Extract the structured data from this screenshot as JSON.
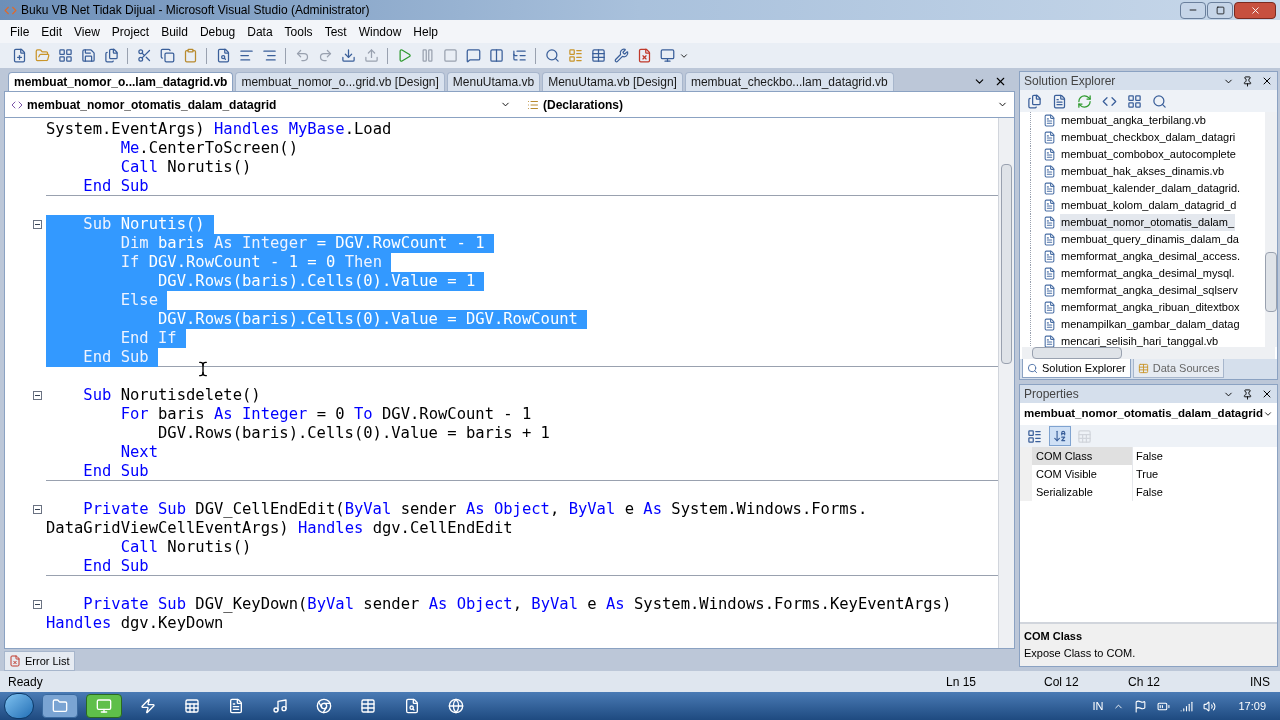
{
  "window": {
    "title": "Buku VB Net Tidak Dijual - Microsoft Visual Studio (Administrator)"
  },
  "menu": [
    "File",
    "Edit",
    "View",
    "Project",
    "Build",
    "Debug",
    "Data",
    "Tools",
    "Test",
    "Window",
    "Help"
  ],
  "document_tabs": [
    {
      "label": "membuat_nomor_o...lam_datagrid.vb",
      "selected": true
    },
    {
      "label": "membuat_nomor_o...grid.vb [Design]",
      "selected": false
    },
    {
      "label": "MenuUtama.vb",
      "selected": false
    },
    {
      "label": "MenuUtama.vb [Design]",
      "selected": false
    },
    {
      "label": "membuat_checkbo...lam_datagrid.vb",
      "selected": false
    }
  ],
  "navigation": {
    "class_dropdown": "membuat_nomor_otomatis_dalam_datagrid",
    "member_dropdown": "(Declarations)"
  },
  "code_lines": [
    {
      "kind": "code",
      "tokens": [
        {
          "text": "System.EventArgs) ",
          "kind": "plain"
        },
        {
          "text": "Handles MyBase",
          "kind": "keyword"
        },
        {
          "text": ".Load",
          "kind": "plain"
        }
      ],
      "selected": false,
      "collapsible": false,
      "separator": false
    },
    {
      "kind": "code",
      "tokens": [
        {
          "text": "        Me",
          "kind": "keyword"
        },
        {
          "text": ".CenterToScreen()",
          "kind": "plain"
        }
      ],
      "selected": false,
      "collapsible": false,
      "separator": false
    },
    {
      "kind": "code",
      "tokens": [
        {
          "text": "        Call",
          "kind": "keyword"
        },
        {
          "text": " Norutis()",
          "kind": "plain"
        }
      ],
      "selected": false,
      "collapsible": false,
      "separator": false
    },
    {
      "kind": "code",
      "tokens": [
        {
          "text": "    End Sub",
          "kind": "keyword"
        }
      ],
      "selected": false,
      "collapsible": false,
      "separator": true
    },
    {
      "kind": "blank"
    },
    {
      "kind": "code",
      "tokens": [
        {
          "text": "    Sub",
          "kind": "keyword"
        },
        {
          "text": " Norutis()",
          "kind": "plain"
        }
      ],
      "selected": true,
      "collapsible": true,
      "separator": false
    },
    {
      "kind": "code",
      "tokens": [
        {
          "text": "        Dim",
          "kind": "keyword"
        },
        {
          "text": " baris ",
          "kind": "plain"
        },
        {
          "text": "As Integer",
          "kind": "keyword"
        },
        {
          "text": " = DGV.RowCount - 1",
          "kind": "plain"
        }
      ],
      "selected": true,
      "collapsible": false,
      "separator": false
    },
    {
      "kind": "code",
      "tokens": [
        {
          "text": "        If",
          "kind": "keyword"
        },
        {
          "text": " DGV.RowCount - 1 = 0 ",
          "kind": "plain"
        },
        {
          "text": "Then",
          "kind": "keyword"
        }
      ],
      "selected": true,
      "collapsible": false,
      "separator": false
    },
    {
      "kind": "code",
      "tokens": [
        {
          "text": "            DGV.Rows(baris).Cells(0).Value = 1",
          "kind": "plain"
        }
      ],
      "selected": true,
      "collapsible": false,
      "separator": false
    },
    {
      "kind": "code",
      "tokens": [
        {
          "text": "        Else",
          "kind": "keyword"
        }
      ],
      "selected": true,
      "collapsible": false,
      "separator": false
    },
    {
      "kind": "code",
      "tokens": [
        {
          "text": "            DGV.Rows(baris).Cells(0).Value = DGV.RowCount",
          "kind": "plain"
        }
      ],
      "selected": true,
      "collapsible": false,
      "separator": false
    },
    {
      "kind": "code",
      "tokens": [
        {
          "text": "        End If",
          "kind": "keyword"
        }
      ],
      "selected": true,
      "collapsible": false,
      "separator": false
    },
    {
      "kind": "code",
      "tokens": [
        {
          "text": "    End Sub",
          "kind": "keyword"
        }
      ],
      "selected": true,
      "collapsible": false,
      "separator": true
    },
    {
      "kind": "blank"
    },
    {
      "kind": "code",
      "tokens": [
        {
          "text": "    Sub",
          "kind": "keyword"
        },
        {
          "text": " Norutisdelete()",
          "kind": "plain"
        }
      ],
      "selected": false,
      "collapsible": true,
      "separator": false
    },
    {
      "kind": "code",
      "tokens": [
        {
          "text": "        For",
          "kind": "keyword"
        },
        {
          "text": " baris ",
          "kind": "plain"
        },
        {
          "text": "As Integer",
          "kind": "keyword"
        },
        {
          "text": " = 0 ",
          "kind": "plain"
        },
        {
          "text": "To",
          "kind": "keyword"
        },
        {
          "text": " DGV.RowCount - 1",
          "kind": "plain"
        }
      ],
      "selected": false,
      "collapsible": false,
      "separator": false
    },
    {
      "kind": "code",
      "tokens": [
        {
          "text": "            DGV.Rows(baris).Cells(0).Value = baris + 1",
          "kind": "plain"
        }
      ],
      "selected": false,
      "collapsible": false,
      "separator": false
    },
    {
      "kind": "code",
      "tokens": [
        {
          "text": "        Next",
          "kind": "keyword"
        }
      ],
      "selected": false,
      "collapsible": false,
      "separator": false
    },
    {
      "kind": "code",
      "tokens": [
        {
          "text": "    End Sub",
          "kind": "keyword"
        }
      ],
      "selected": false,
      "collapsible": false,
      "separator": true
    },
    {
      "kind": "blank"
    },
    {
      "kind": "code",
      "tokens": [
        {
          "text": "    Private Sub",
          "kind": "keyword"
        },
        {
          "text": " DGV_CellEndEdit(",
          "kind": "plain"
        },
        {
          "text": "ByVal",
          "kind": "keyword"
        },
        {
          "text": " sender ",
          "kind": "plain"
        },
        {
          "text": "As Object",
          "kind": "keyword"
        },
        {
          "text": ", ",
          "kind": "plain"
        },
        {
          "text": "ByVal",
          "kind": "keyword"
        },
        {
          "text": " e ",
          "kind": "plain"
        },
        {
          "text": "As",
          "kind": "keyword"
        },
        {
          "text": " System.Windows.Forms.",
          "kind": "plain"
        }
      ],
      "selected": false,
      "collapsible": true,
      "separator": false
    },
    {
      "kind": "code",
      "tokens": [
        {
          "text": "DataGridViewCellEventArgs) ",
          "kind": "plain"
        },
        {
          "text": "Handles",
          "kind": "keyword"
        },
        {
          "text": " dgv.CellEndEdit",
          "kind": "plain"
        }
      ],
      "selected": false,
      "collapsible": false,
      "separator": false
    },
    {
      "kind": "code",
      "tokens": [
        {
          "text": "        Call",
          "kind": "keyword"
        },
        {
          "text": " Norutis()",
          "kind": "plain"
        }
      ],
      "selected": false,
      "collapsible": false,
      "separator": false
    },
    {
      "kind": "code",
      "tokens": [
        {
          "text": "    End Sub",
          "kind": "keyword"
        }
      ],
      "selected": false,
      "collapsible": false,
      "separator": true
    },
    {
      "kind": "blank"
    },
    {
      "kind": "code",
      "tokens": [
        {
          "text": "    Private Sub",
          "kind": "keyword"
        },
        {
          "text": " DGV_KeyDown(",
          "kind": "plain"
        },
        {
          "text": "ByVal",
          "kind": "keyword"
        },
        {
          "text": " sender ",
          "kind": "plain"
        },
        {
          "text": "As Object",
          "kind": "keyword"
        },
        {
          "text": ", ",
          "kind": "plain"
        },
        {
          "text": "ByVal",
          "kind": "keyword"
        },
        {
          "text": " e ",
          "kind": "plain"
        },
        {
          "text": "As",
          "kind": "keyword"
        },
        {
          "text": " System.Windows.Forms.KeyEventArgs)",
          "kind": "plain"
        }
      ],
      "selected": false,
      "collapsible": true,
      "separator": false
    },
    {
      "kind": "code",
      "tokens": [
        {
          "text": "Handles",
          "kind": "keyword"
        },
        {
          "text": " dgv.KeyDown",
          "kind": "plain"
        }
      ],
      "selected": false,
      "collapsible": false,
      "separator": false
    }
  ],
  "solution_explorer": {
    "title": "Solution Explorer",
    "files": [
      {
        "name": "membuat_angka_terbilang.vb",
        "selected": false
      },
      {
        "name": "membuat_checkbox_dalam_datagri",
        "selected": false
      },
      {
        "name": "membuat_combobox_autocomplete",
        "selected": false
      },
      {
        "name": "membuat_hak_akses_dinamis.vb",
        "selected": false
      },
      {
        "name": "membuat_kalender_dalam_datagrid.",
        "selected": false
      },
      {
        "name": "membuat_kolom_dalam_datagrid_d",
        "selected": false
      },
      {
        "name": "membuat_nomor_otomatis_dalam_",
        "selected": true
      },
      {
        "name": "membuat_query_dinamis_dalam_da",
        "selected": false
      },
      {
        "name": "memformat_angka_desimal_access.",
        "selected": false
      },
      {
        "name": "memformat_angka_desimal_mysql.",
        "selected": false
      },
      {
        "name": "memformat_angka_desimal_sqlserv",
        "selected": false
      },
      {
        "name": "memformat_angka_ribuan_ditextbox",
        "selected": false
      },
      {
        "name": "menampilkan_gambar_dalam_datag",
        "selected": false
      },
      {
        "name": "mencari_selisih_hari_tanggal.vb",
        "selected": false
      }
    ],
    "tabs": [
      {
        "label": "Solution Explorer",
        "selected": true
      },
      {
        "label": "Data Sources",
        "selected": false
      }
    ]
  },
  "properties": {
    "title": "Properties",
    "object": "membuat_nomor_otomatis_dalam_datagrid",
    "rows": [
      {
        "name": "COM Class",
        "value": "False",
        "selected": true
      },
      {
        "name": "COM Visible",
        "value": "True",
        "selected": false
      },
      {
        "name": "Serializable",
        "value": "False",
        "selected": false
      }
    ],
    "description": {
      "title": "COM Class",
      "text": "Expose Class to COM."
    }
  },
  "bottom_tabs": [
    "Error List"
  ],
  "status_bar": {
    "status": "Ready",
    "line": "Ln 15",
    "column": "Col 12",
    "character": "Ch 12",
    "mode": "INS"
  },
  "taskbar": {
    "language": "IN",
    "clock": "17:09"
  }
}
